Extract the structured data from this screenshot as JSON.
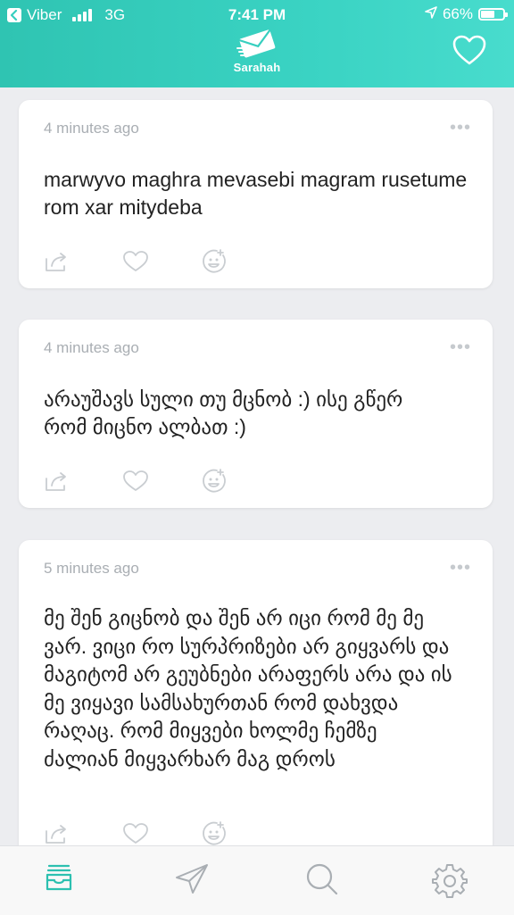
{
  "status_bar": {
    "back_app": "Viber",
    "network": "3G",
    "time": "7:41 PM",
    "battery_percent": "66%",
    "battery_level": 0.66
  },
  "header": {
    "brand": "Sarahah",
    "accent": "#37cfbf"
  },
  "messages": [
    {
      "time": "4 minutes ago",
      "text": "marwyvo maghra mevasebi magram rusetume rom xar mitydeba"
    },
    {
      "time": "4 minutes ago",
      "text": "არაუშავს სული თუ მცნობ :) ისე გწერ რომ მიცნო ალბათ :)"
    },
    {
      "time": "5 minutes ago",
      "text": "მე შენ გიცნობ და შენ არ იცი რომ მე მე ვარ. ვიცი რო სურპრიზები არ გიყვარს და მაგიტომ არ გეუბნები არაფერს არა და ის მე ვიყავი სამსახურთან რომ დახვდა რაღაც. რომ მიყვები ხოლმე ჩემზე ძალიან მიყვარხარ მაგ დროს"
    }
  ],
  "card_icons": [
    "share-icon",
    "heart-icon",
    "smiley-icon"
  ],
  "tabbar": {
    "active_color": "#2cc0b0",
    "tabs": [
      {
        "icon": "inbox-icon",
        "active": true
      },
      {
        "icon": "send-icon",
        "active": false
      },
      {
        "icon": "search-icon",
        "active": false
      },
      {
        "icon": "settings-icon",
        "active": false
      }
    ]
  }
}
